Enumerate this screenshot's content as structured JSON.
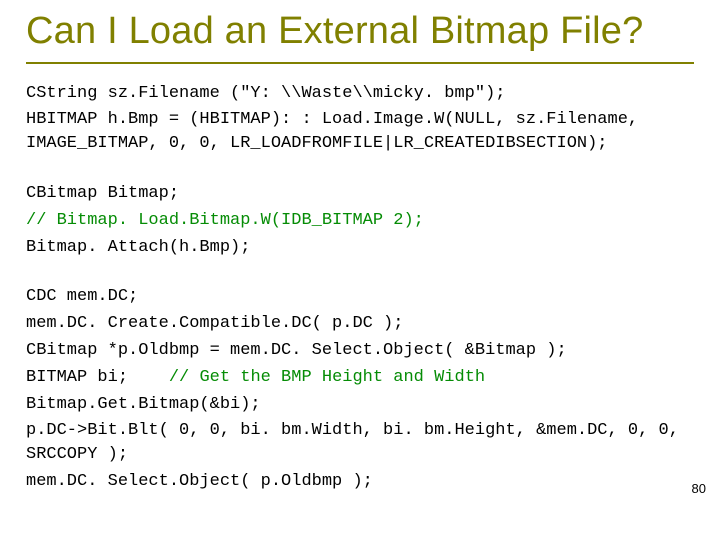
{
  "title": "Can I Load an External Bitmap File?",
  "blocks": [
    {
      "lines": [
        {
          "text": "CString sz.Filename (\"Y: \\\\Waste\\\\micky. bmp\");"
        },
        {
          "text": "HBITMAP h.Bmp = (HBITMAP): : Load.Image.W(NULL, sz.Filename, IMAGE_BITMAP, 0, 0, LR_LOADFROMFILE|LR_CREATEDIBSECTION);"
        }
      ]
    },
    {
      "lines": [
        {
          "text": "CBitmap Bitmap;"
        },
        {
          "text": "// Bitmap. Load.Bitmap.W(IDB_BITMAP 2);",
          "comment": true
        },
        {
          "text": "Bitmap. Attach(h.Bmp);"
        }
      ]
    },
    {
      "lines": [
        {
          "text": "CDC mem.DC;"
        },
        {
          "text": "mem.DC. Create.Compatible.DC( p.DC );"
        },
        {
          "text": "CBitmap *p.Oldbmp = mem.DC. Select.Object( &Bitmap );"
        },
        {
          "text": "BITMAP bi;",
          "inline_comment": "// Get the BMP Height and Width"
        },
        {
          "text": "Bitmap.Get.Bitmap(&bi);"
        },
        {
          "text": "p.DC->Bit.Blt( 0, 0, bi. bm.Width, bi. bm.Height, &mem.DC, 0, 0, SRCCOPY );"
        },
        {
          "text": "mem.DC. Select.Object( p.Oldbmp );"
        }
      ]
    }
  ],
  "slide_number": "80"
}
